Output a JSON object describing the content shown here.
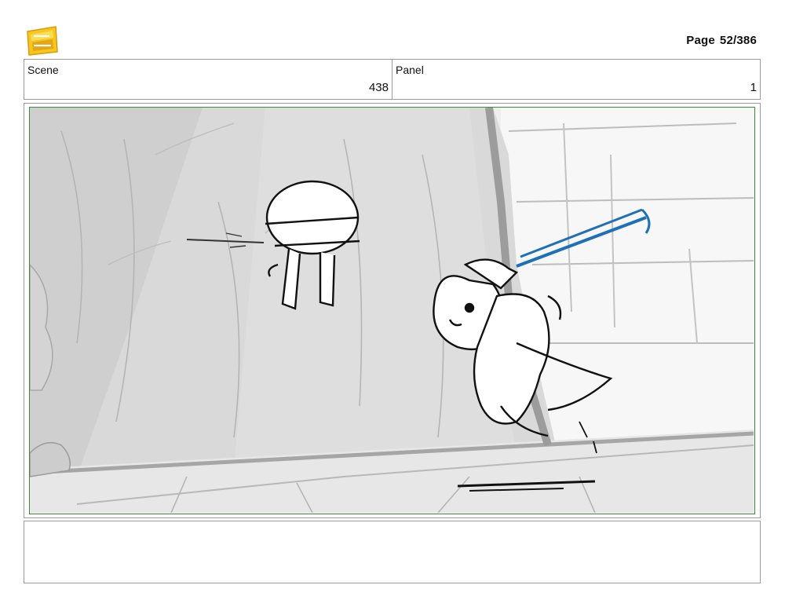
{
  "logo": {
    "icon": "star-wars-young-jedi-adventures-logo"
  },
  "header": {
    "page_label": "Page",
    "page_number": "52/386"
  },
  "info": {
    "scene_label": "Scene",
    "scene_value": "438",
    "panel_label": "Panel",
    "panel_value": "1"
  },
  "panel": {
    "frame_color": "#3f8a3f",
    "saber_color": "#1f6fb8"
  },
  "notes": {
    "text": ""
  }
}
